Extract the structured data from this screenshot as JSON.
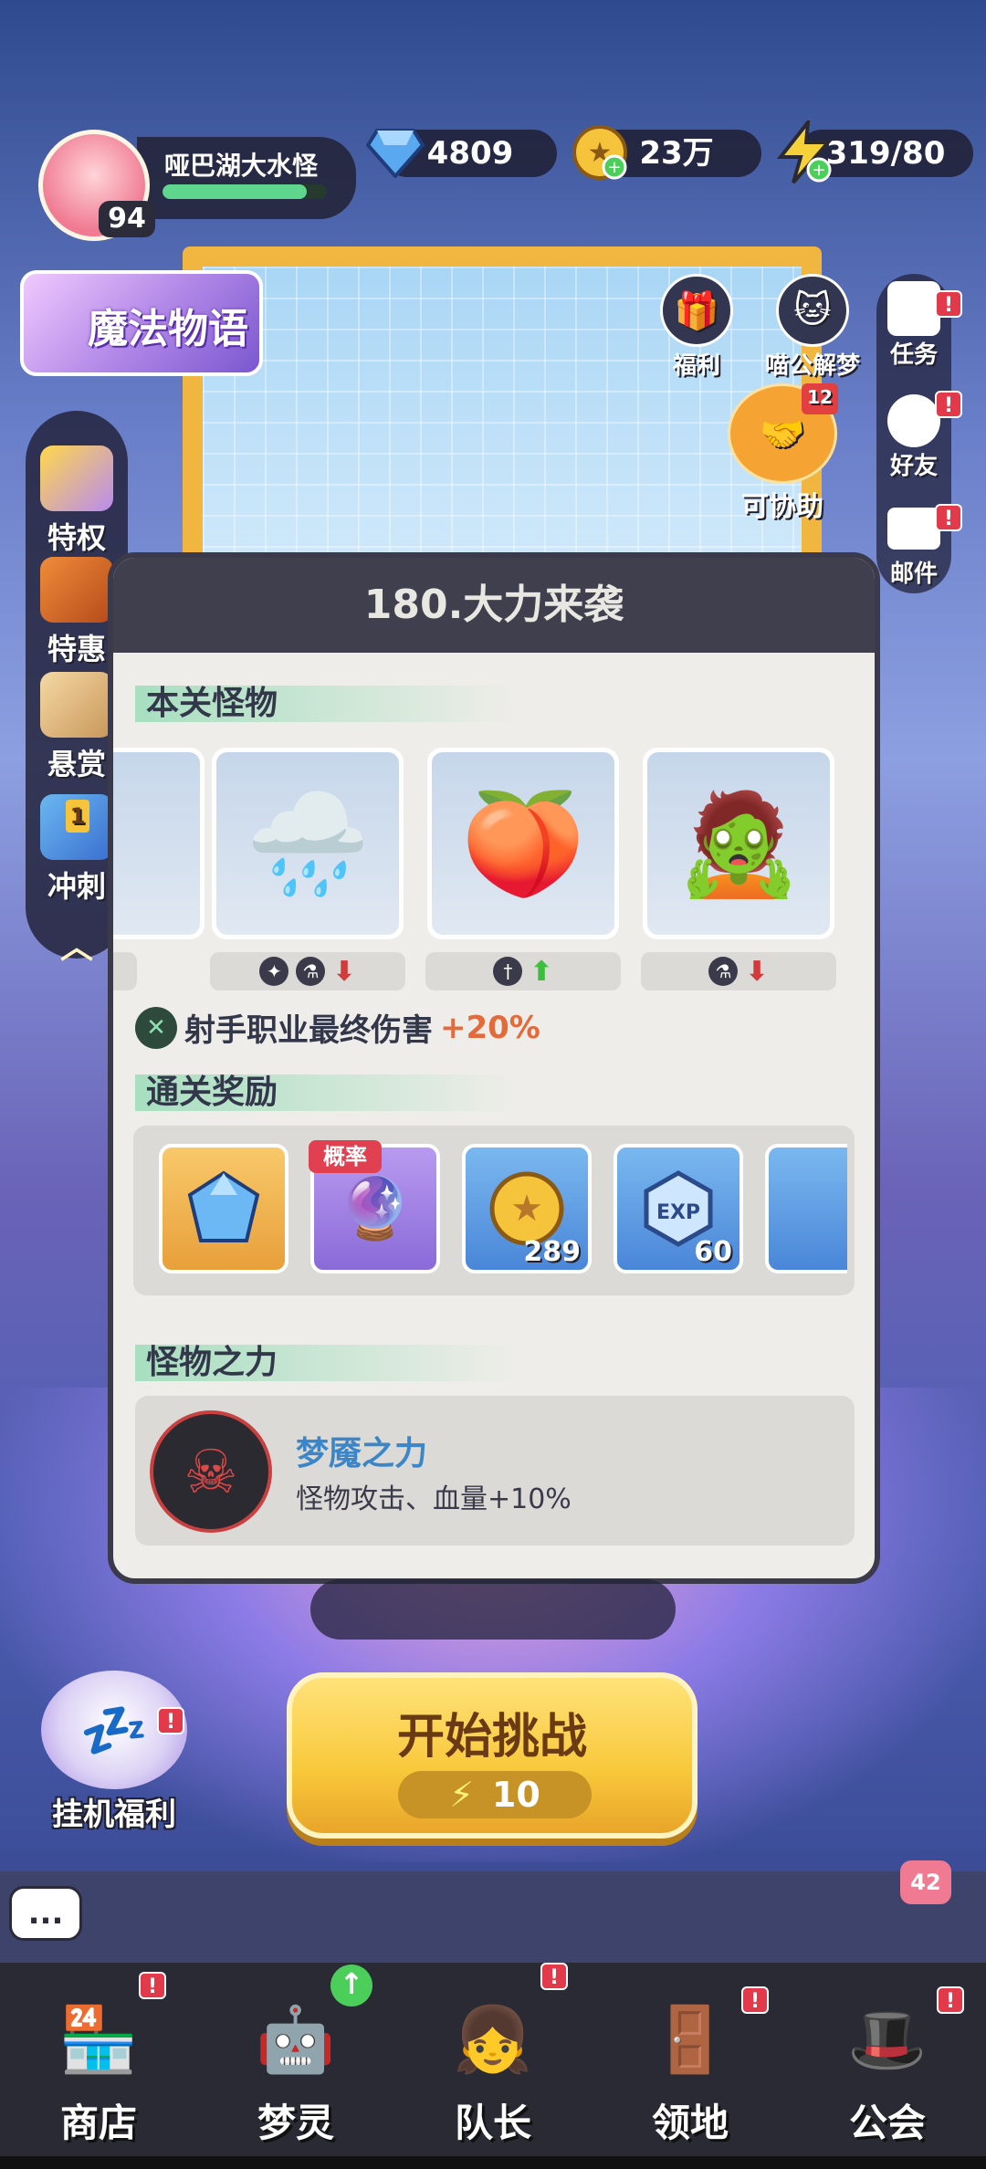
{
  "player": {
    "name": "哑巴湖大水怪",
    "level": "94",
    "xp_fraction": 0.88
  },
  "currencies": [
    {
      "name": "diamond",
      "value": "4809"
    },
    {
      "name": "gold",
      "value": "23万"
    },
    {
      "name": "energy",
      "value": "319/80"
    }
  ],
  "banner": {
    "label": "魔法物语"
  },
  "top_buttons": [
    {
      "label": "福利"
    },
    {
      "label": "喵公解梦"
    }
  ],
  "assist": {
    "label": "可协助",
    "count": "12"
  },
  "right_menu": [
    {
      "label": "任务",
      "badge": "!"
    },
    {
      "label": "好友",
      "badge": "!"
    },
    {
      "label": "邮件",
      "badge": "!"
    }
  ],
  "left_menu": [
    {
      "label": "特权"
    },
    {
      "label": "特惠"
    },
    {
      "label": "悬赏"
    },
    {
      "label": "冲刺",
      "tag": "1"
    }
  ],
  "stage": {
    "title": "180.大力来袭",
    "monsters_title": "本关怪物",
    "bonus_text": "射手职业最终伤害",
    "bonus_value": "+20%",
    "rewards_title": "通关奖励",
    "rewards": [
      {
        "icon": "gem-icon",
        "count": ""
      },
      {
        "icon": "mystery-icon",
        "count": "",
        "tag": "概率"
      },
      {
        "icon": "coin-icon",
        "count": "289"
      },
      {
        "icon": "exp-icon",
        "count": "60"
      }
    ],
    "power_title": "怪物之力",
    "power_name": "梦魇之力",
    "power_desc": "怪物攻击、血量+10%"
  },
  "challenge": {
    "label": "开始挑战",
    "cost": "10"
  },
  "idle": {
    "label": "挂机福利",
    "badge": "!"
  },
  "chat": {
    "label": "...",
    "unread": "42"
  },
  "nav": [
    {
      "label": "商店",
      "badge": "!"
    },
    {
      "label": "梦灵",
      "badge": "↑"
    },
    {
      "label": "队长",
      "badge": "!"
    },
    {
      "label": "领地",
      "badge": "!"
    },
    {
      "label": "公会",
      "badge": "!"
    }
  ],
  "colors": {
    "accent": "#f8c83a",
    "bonus": "#e36a3a",
    "power_name": "#3a86c8",
    "badge": "#e23a4b"
  }
}
